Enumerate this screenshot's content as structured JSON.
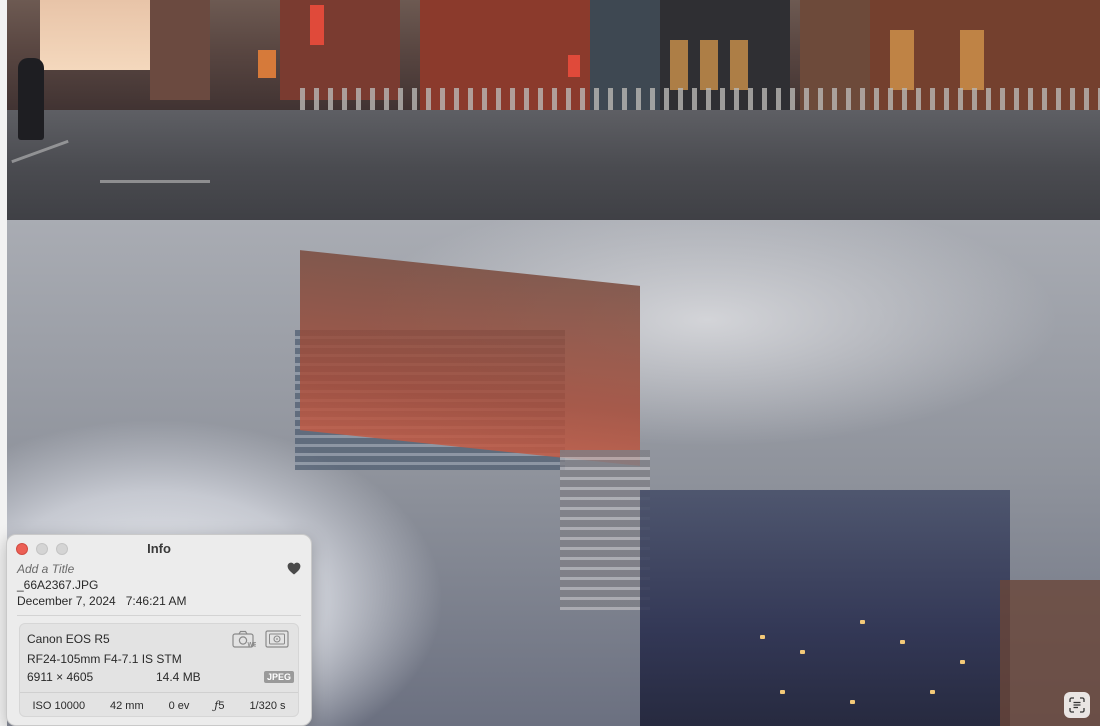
{
  "info_panel": {
    "title": "Info",
    "add_title_placeholder": "Add a Title",
    "filename": "_66A2367.JPG",
    "date": "December 7, 2024",
    "time": "7:46:21 AM",
    "camera": {
      "model": "Canon EOS R5",
      "lens": "RF24-105mm F4-7.1 IS STM",
      "dimensions": "6911 × 4605",
      "file_size": "14.4 MB",
      "format_badge": "JPEG",
      "iso": "ISO 10000",
      "focal_length": "42 mm",
      "exposure_bias": "0 ev",
      "aperture_symbol": "ƒ",
      "aperture_value": "5",
      "shutter_speed": "1/320 s"
    },
    "icons": {
      "favorite": "heart-icon",
      "white_balance": "camera-wb-icon",
      "metering": "metering-mode-icon"
    }
  },
  "overlay": {
    "live_text_icon": "live-text-icon"
  },
  "colors": {
    "close_button": "#ec5f55",
    "panel_background": "#ececec"
  }
}
